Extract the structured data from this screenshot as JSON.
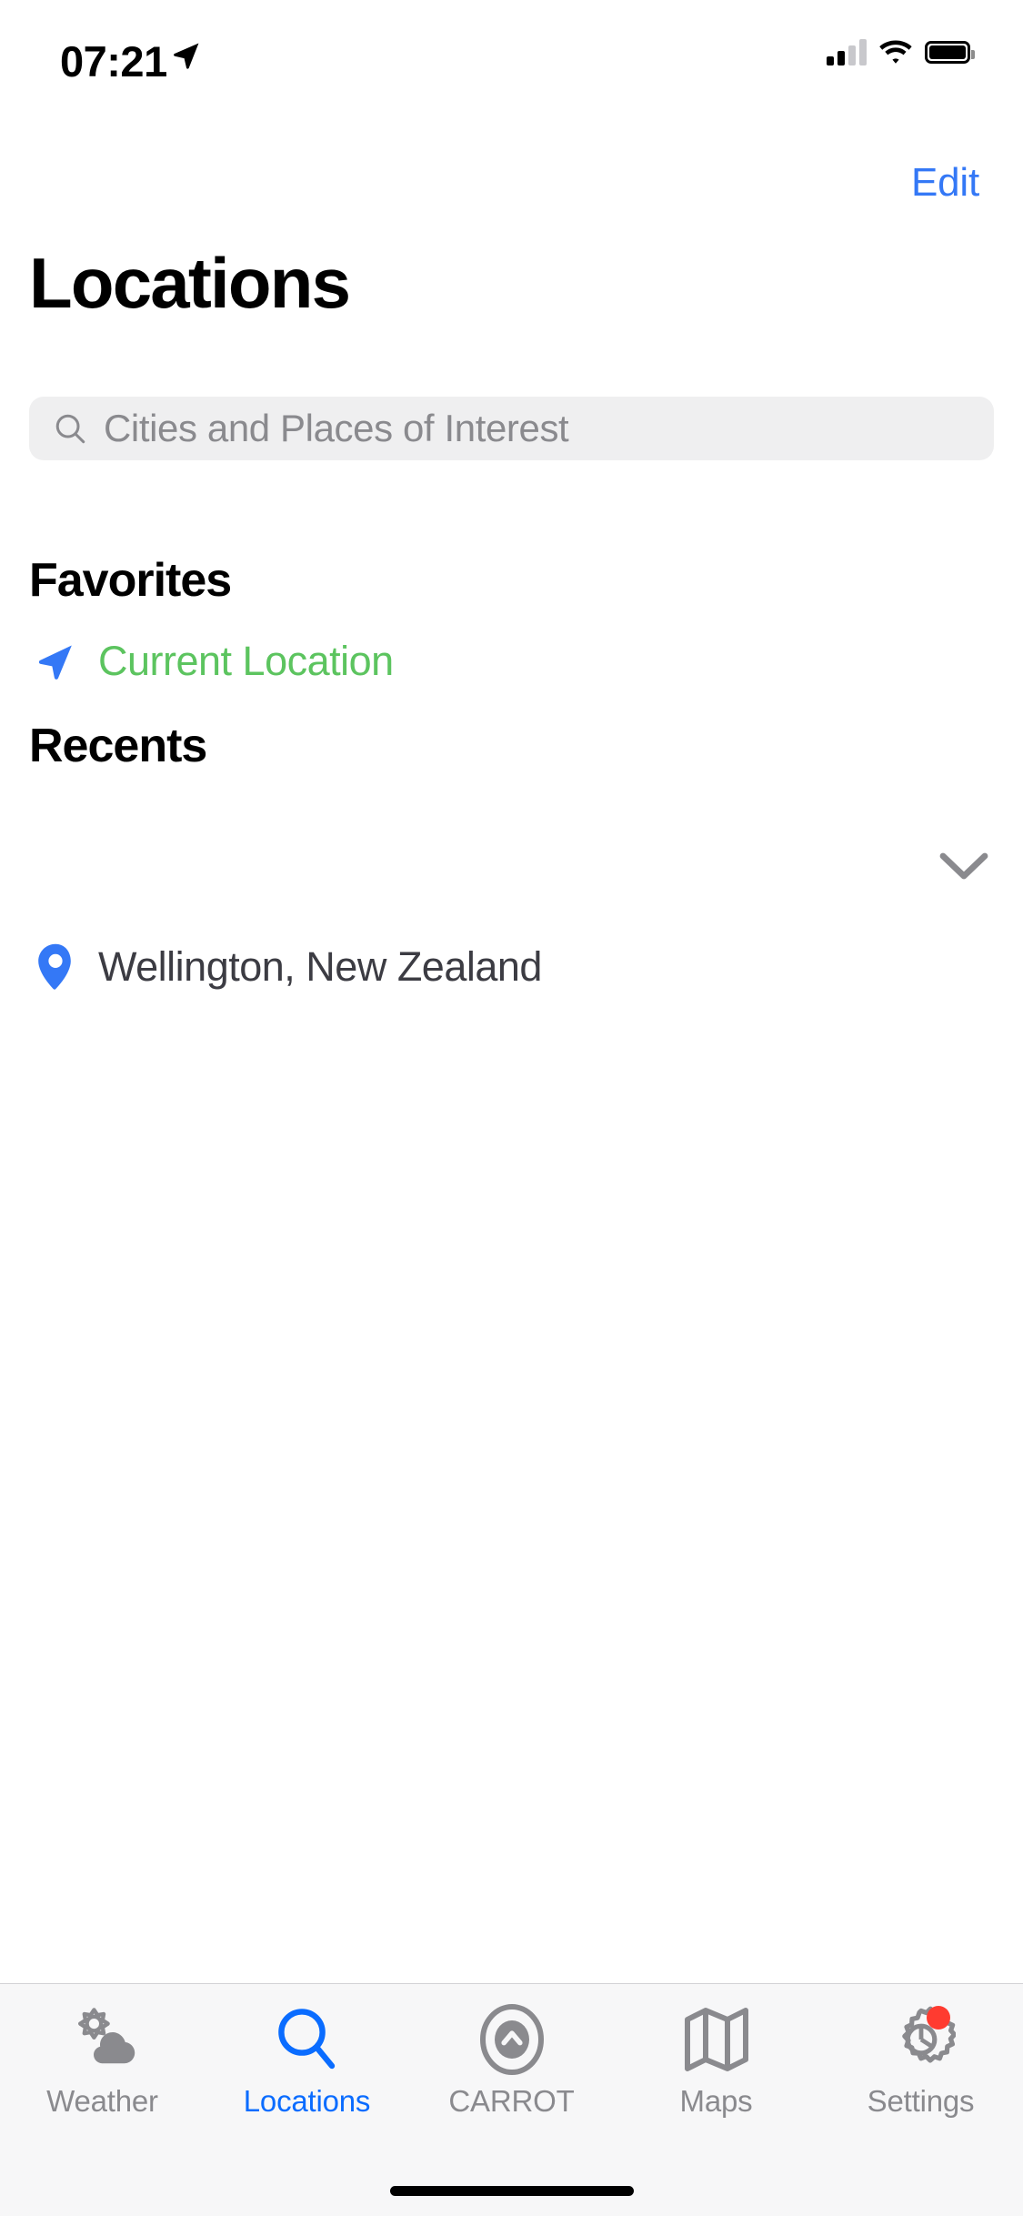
{
  "status_bar": {
    "time": "07:21",
    "location_arrow_icon": "location-arrow-icon",
    "cellular_icon": "cellular-signal-icon",
    "cellular_bars_filled": 2,
    "cellular_bars_total": 4,
    "wifi_icon": "wifi-icon",
    "battery_icon": "battery-full-icon"
  },
  "nav": {
    "edit_label": "Edit",
    "edit_color": "#3478F6"
  },
  "header": {
    "title": "Locations"
  },
  "search": {
    "placeholder": "Cities and Places of Interest",
    "icon": "search-icon",
    "value": "",
    "background": "#EFEFF0",
    "placeholder_color": "#8A8A8E"
  },
  "sections": [
    {
      "id": "favorites",
      "title": "Favorites",
      "collapsible": false,
      "rows": [
        {
          "id": "current-location",
          "label": "Current Location",
          "icon": "navigation-arrow-icon",
          "icon_color": "#3478F6",
          "label_color": "#5CC45F"
        }
      ]
    },
    {
      "id": "recents",
      "title": "Recents",
      "collapsible": true,
      "chevron_icon": "chevron-down-icon",
      "chevron_color": "#8A8A8E",
      "rows": [
        {
          "id": "wellington",
          "label": "Wellington, New Zealand",
          "icon": "map-pin-icon",
          "icon_color": "#3478F6",
          "label_color": "#3C3C43"
        }
      ]
    }
  ],
  "tab_bar": {
    "active_color": "#0A6CFF",
    "inactive_color": "#8A8A8E",
    "badge_color": "#FF3B30",
    "items": [
      {
        "id": "weather",
        "label": "Weather",
        "icon": "sun-cloud-icon",
        "active": false,
        "badge": false
      },
      {
        "id": "locations",
        "label": "Locations",
        "icon": "search-icon",
        "active": true,
        "badge": false
      },
      {
        "id": "carrot",
        "label": "CARROT",
        "icon": "carrot-chevron-up-icon",
        "active": false,
        "badge": false
      },
      {
        "id": "maps",
        "label": "Maps",
        "icon": "folded-map-icon",
        "active": false,
        "badge": false
      },
      {
        "id": "settings",
        "label": "Settings",
        "icon": "gear-icon",
        "active": false,
        "badge": true
      }
    ]
  },
  "home_indicator": "home-indicator"
}
